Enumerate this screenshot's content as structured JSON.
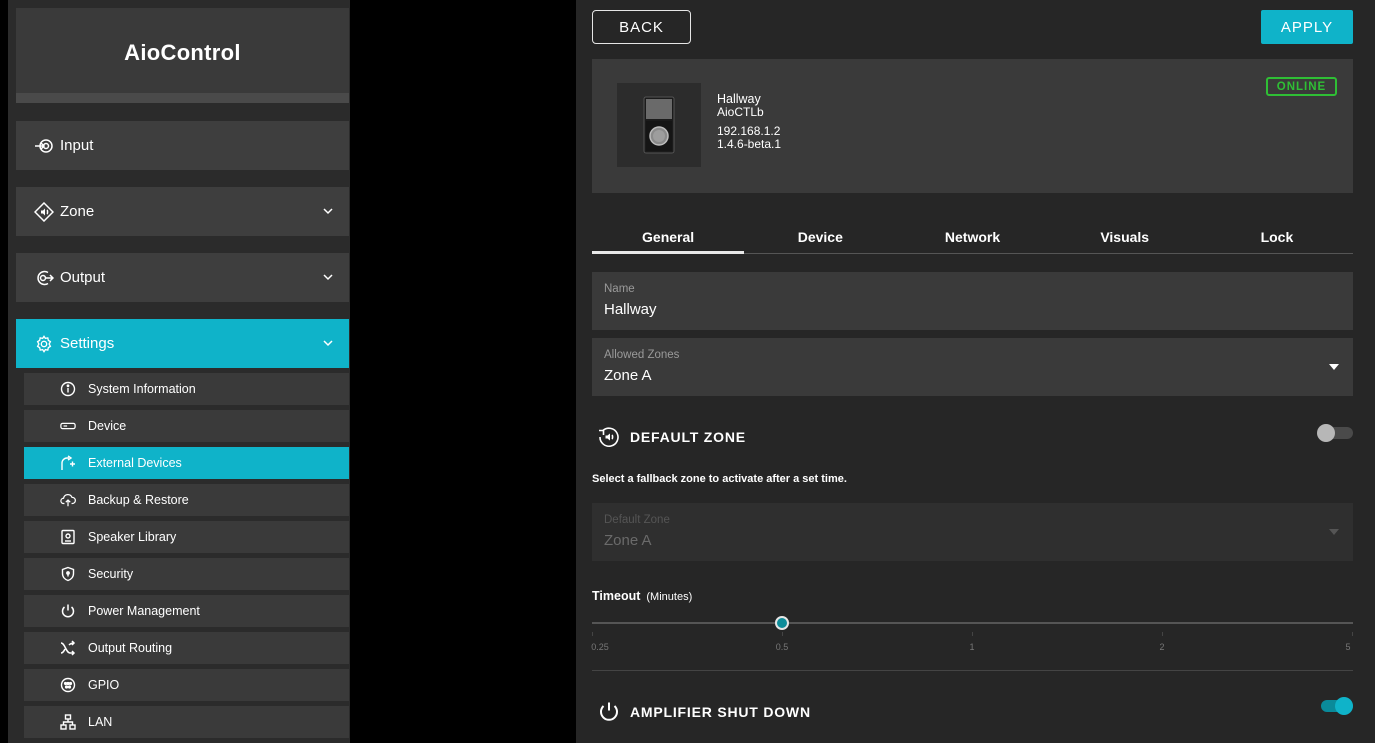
{
  "brand": {
    "name": "AioControl"
  },
  "sidebar": {
    "main_items": [
      {
        "label": "Input",
        "icon": "input-icon"
      },
      {
        "label": "Zone",
        "icon": "zone-icon"
      },
      {
        "label": "Output",
        "icon": "output-icon"
      },
      {
        "label": "Settings",
        "icon": "gear-icon"
      }
    ],
    "sub_items": [
      {
        "label": "System Information",
        "icon": "info-icon"
      },
      {
        "label": "Device",
        "icon": "device-icon"
      },
      {
        "label": "External Devices",
        "icon": "external-devices-icon"
      },
      {
        "label": "Backup & Restore",
        "icon": "backup-icon"
      },
      {
        "label": "Speaker Library",
        "icon": "speaker-icon"
      },
      {
        "label": "Security",
        "icon": "shield-icon"
      },
      {
        "label": "Power Management",
        "icon": "power-icon"
      },
      {
        "label": "Output Routing",
        "icon": "shuffle-icon"
      },
      {
        "label": "GPIO",
        "icon": "gpio-icon"
      },
      {
        "label": "LAN",
        "icon": "network-icon"
      }
    ],
    "active_main": "Settings",
    "active_sub": "External Devices"
  },
  "toolbar": {
    "back_label": "BACK",
    "apply_label": "APPLY"
  },
  "device": {
    "name": "Hallway",
    "model": "AioCTLb",
    "ip": "192.168.1.2",
    "firmware": "1.4.6-beta.1",
    "status": "ONLINE"
  },
  "tabs": [
    "General",
    "Device",
    "Network",
    "Visuals",
    "Lock"
  ],
  "active_tab": "General",
  "form": {
    "name_label": "Name",
    "name_value": "Hallway",
    "allowed_zones_label": "Allowed Zones",
    "allowed_zones_value": "Zone A",
    "default_zone_title": "DEFAULT ZONE",
    "default_zone_enabled": false,
    "default_zone_help": "Select a fallback zone to activate after a set time.",
    "default_zone_label": "Default Zone",
    "default_zone_value": "Zone A",
    "timeout_label": "Timeout",
    "timeout_unit": "(Minutes)",
    "timeout_ticks": [
      "0.25",
      "0.5",
      "1",
      "2",
      "5"
    ],
    "timeout_value": "0.5",
    "amp_title": "AMPLIFIER SHUT DOWN",
    "amp_enabled": true
  },
  "colors": {
    "accent": "#0fb3c9",
    "online": "#2fbf35",
    "panel": "#3a3a3a",
    "background": "#262626"
  }
}
